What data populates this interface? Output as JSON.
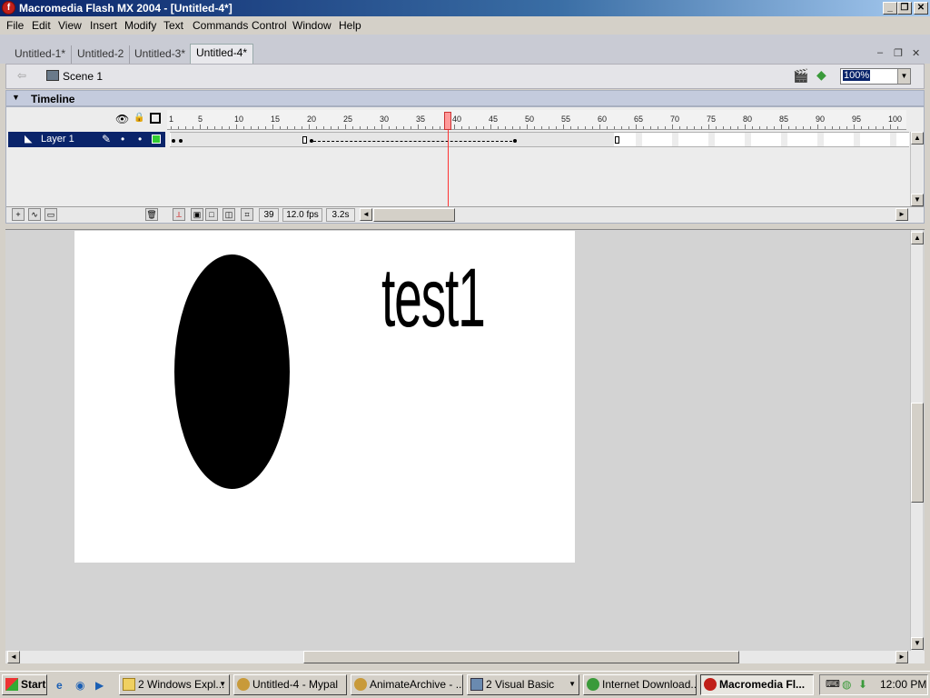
{
  "window": {
    "title": "Macromedia Flash MX 2004 - [Untitled-4*]"
  },
  "menubar": [
    "File",
    "Edit",
    "View",
    "Insert",
    "Modify",
    "Text",
    "Commands",
    "Control",
    "Window",
    "Help"
  ],
  "doc_tabs": [
    "Untitled-1*",
    "Untitled-2",
    "Untitled-3*",
    "Untitled-4*"
  ],
  "active_tab_index": 3,
  "scene": {
    "label": "Scene 1"
  },
  "zoom": {
    "value": "100%"
  },
  "timeline": {
    "title": "Timeline",
    "ruler_labels": [
      "1",
      "5",
      "10",
      "15",
      "20",
      "25",
      "30",
      "35",
      "40",
      "45",
      "50",
      "55",
      "60",
      "65",
      "70",
      "75",
      "80",
      "85",
      "90",
      "95",
      "100"
    ],
    "layer_name": "Layer 1",
    "layer_color": "#33cc33",
    "current_frame": "39",
    "frame_rate": "12.0 fps",
    "elapsed": "3.2s"
  },
  "stage": {
    "text": "test1",
    "background": "#ffffff",
    "shape_color": "#000000"
  },
  "taskbar": {
    "start": "Start",
    "items": [
      {
        "label": "2 Windows Expl...",
        "active": false
      },
      {
        "label": "Untitled-4 - Mypal",
        "active": false
      },
      {
        "label": "AnimateArchive - ...",
        "active": false
      },
      {
        "label": "2 Visual Basic",
        "active": false
      },
      {
        "label": "Internet Download...",
        "active": false
      },
      {
        "label": "Macromedia Fl...",
        "active": true
      }
    ],
    "clock": "12:00 PM"
  },
  "colors": {
    "title_bar": "#0a246a",
    "playhead": "#ff3333",
    "selection": "#0a246a"
  }
}
